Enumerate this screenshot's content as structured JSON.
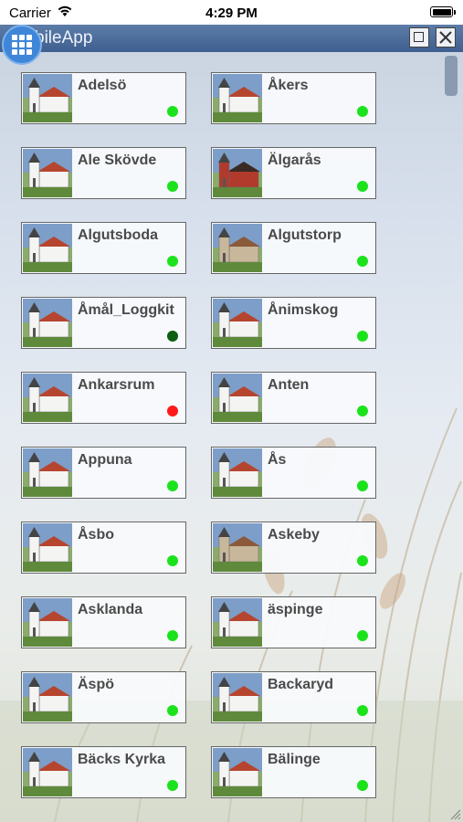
{
  "status_bar": {
    "carrier": "Carrier",
    "time": "4:29 PM"
  },
  "window": {
    "title": "bileApp"
  },
  "churches": [
    {
      "name": "Adelsö",
      "status": "online",
      "thumb": "white"
    },
    {
      "name": "Åkers",
      "status": "online",
      "thumb": "white"
    },
    {
      "name": "Ale Skövde",
      "status": "online",
      "thumb": "white"
    },
    {
      "name": "Älgarås",
      "status": "online",
      "thumb": "red"
    },
    {
      "name": "Algutsboda",
      "status": "online",
      "thumb": "white"
    },
    {
      "name": "Algutstorp",
      "status": "online",
      "thumb": "stone"
    },
    {
      "name": "Åmål_Loggkit",
      "status": "offline",
      "thumb": "white"
    },
    {
      "name": "Ånimskog",
      "status": "online",
      "thumb": "white"
    },
    {
      "name": "Ankarsrum",
      "status": "alarm",
      "thumb": "white"
    },
    {
      "name": "Anten",
      "status": "online",
      "thumb": "white"
    },
    {
      "name": "Appuna",
      "status": "online",
      "thumb": "white"
    },
    {
      "name": "Ås",
      "status": "online",
      "thumb": "white"
    },
    {
      "name": "Åsbo",
      "status": "online",
      "thumb": "white"
    },
    {
      "name": "Askeby",
      "status": "online",
      "thumb": "stone"
    },
    {
      "name": "Asklanda",
      "status": "online",
      "thumb": "white"
    },
    {
      "name": "äspinge",
      "status": "online",
      "thumb": "white"
    },
    {
      "name": "Äspö",
      "status": "online",
      "thumb": "white"
    },
    {
      "name": "Backaryd",
      "status": "online",
      "thumb": "white"
    },
    {
      "name": "Bäcks Kyrka",
      "status": "online",
      "thumb": "white"
    },
    {
      "name": "Bälinge",
      "status": "online",
      "thumb": "white"
    }
  ],
  "colors": {
    "online": "#1be31b",
    "offline": "#0d5e12",
    "alarm": "#ff1a1a",
    "titlebar": "#4a6a98"
  }
}
